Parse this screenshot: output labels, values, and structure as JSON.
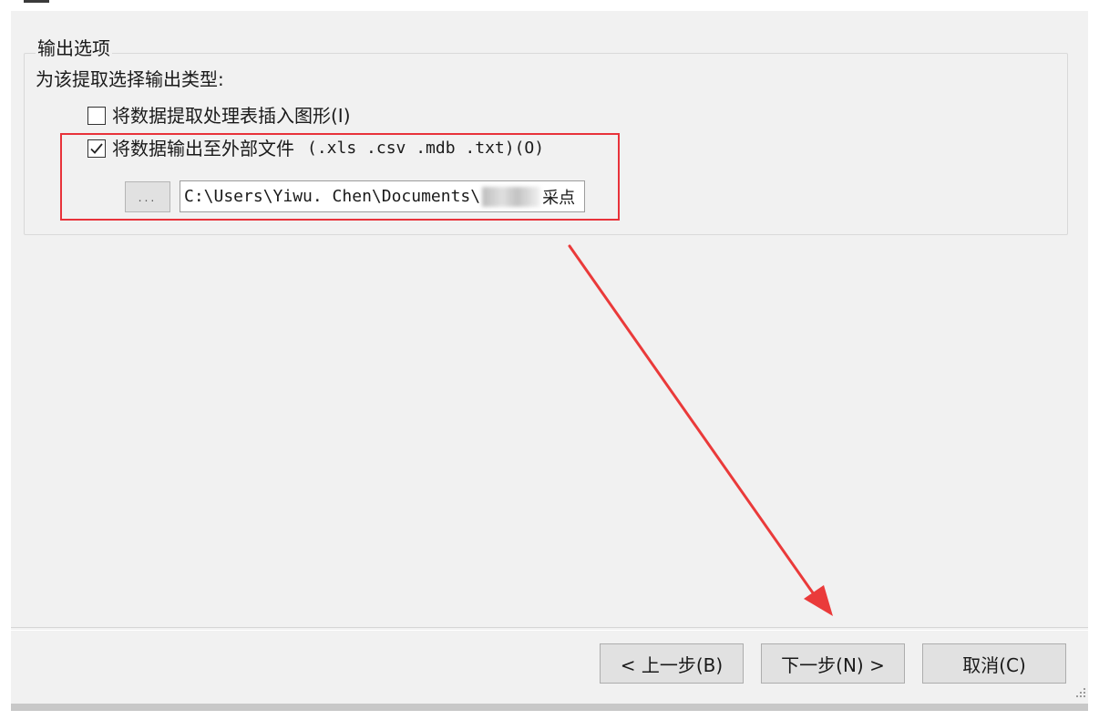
{
  "group": {
    "title": "输出选项",
    "prompt": "为该提取选择输出类型:"
  },
  "options": [
    {
      "label": "将数据提取处理表插入图形(I)",
      "checked": false
    },
    {
      "label": "将数据输出至外部文件",
      "extensions": "(.xls .csv .mdb .txt)(O)",
      "checked": true
    }
  ],
  "file": {
    "browse_label": "...",
    "path_prefix": "C:\\Users\\Yiwu. Chen\\Documents\\",
    "path_suffix": "采点"
  },
  "buttons": {
    "prev": "< 上一步(B)",
    "next": "下一步(N) >",
    "cancel": "取消(C)"
  },
  "colors": {
    "highlight": "#e8323a",
    "dialog_bg": "#f1f1f1",
    "button_bg": "#e1e1e1"
  }
}
